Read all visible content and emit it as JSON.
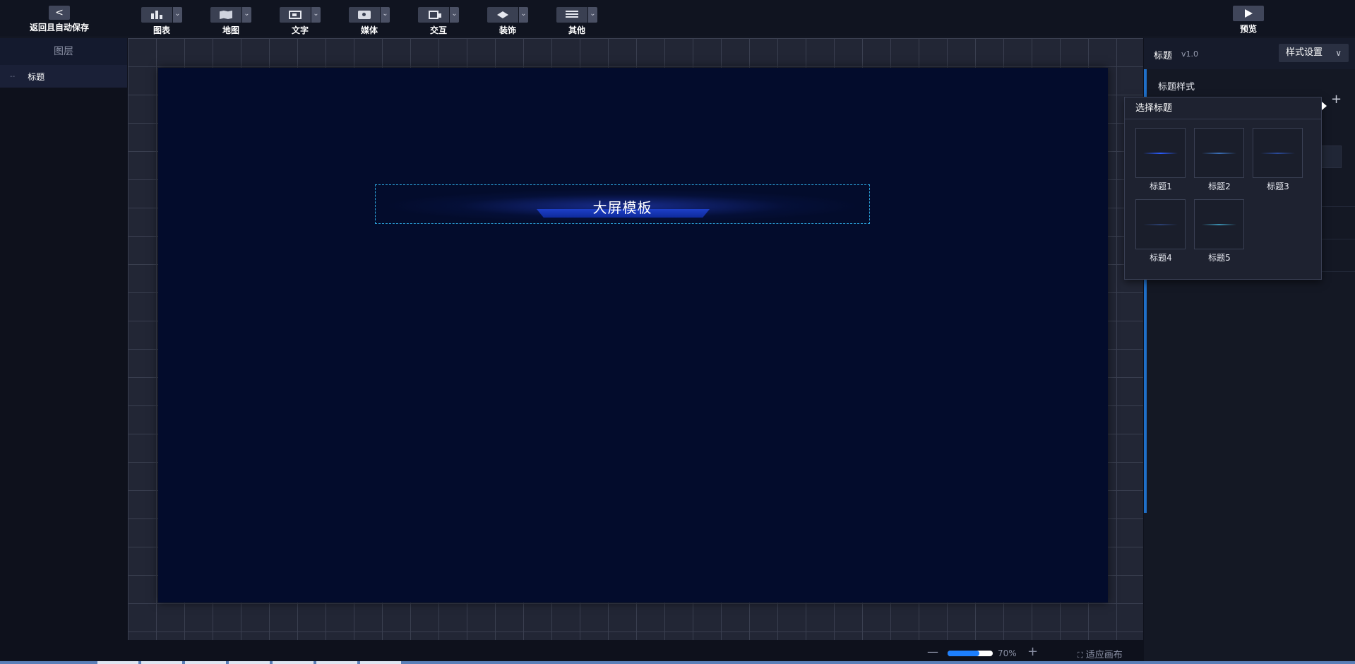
{
  "topbar": {
    "back_label": "返回且自动保存",
    "back_icon": "chevron-left-icon",
    "tools": [
      {
        "label": "图表",
        "icon": "bar-chart-icon"
      },
      {
        "label": "地图",
        "icon": "map-icon"
      },
      {
        "label": "文字",
        "icon": "text-icon"
      },
      {
        "label": "媒体",
        "icon": "media-icon"
      },
      {
        "label": "交互",
        "icon": "interaction-icon"
      },
      {
        "label": "装饰",
        "icon": "decoration-icon"
      },
      {
        "label": "其他",
        "icon": "more-list-icon"
      }
    ],
    "preview_label": "预览",
    "preview_icon": "play-icon"
  },
  "layers": {
    "title": "图层",
    "items": [
      {
        "label": "标题",
        "marker": "--"
      }
    ]
  },
  "canvas": {
    "title_text": "大屏模板",
    "background_color": "#030c2c",
    "selection_border_color": "#2aa0d8"
  },
  "statusbar": {
    "zoom_percent": 70,
    "zoom_label": "70%",
    "zoom_out_symbol": "—",
    "zoom_in_symbol": "+",
    "fit_label": "适应画布",
    "fit_icon": "fit-screen-icon"
  },
  "rightpanel": {
    "component_name": "标题",
    "version": "v1.0",
    "mode_label": "样式设置",
    "mode_chevron": "∨",
    "style_section_label": "标题样式",
    "add_symbol": "+",
    "accent_color": "#1f6fc8"
  },
  "title_picker": {
    "heading": "选择标题",
    "options": [
      {
        "label": "标题1",
        "line_color": "#2a5cff"
      },
      {
        "label": "标题2",
        "line_color": "#3a6fb8"
      },
      {
        "label": "标题3",
        "line_color": "#2a4a9a"
      },
      {
        "label": "标题4",
        "line_color": "#2a3f70"
      },
      {
        "label": "标题5",
        "line_color": "#3a8fb0"
      }
    ]
  }
}
